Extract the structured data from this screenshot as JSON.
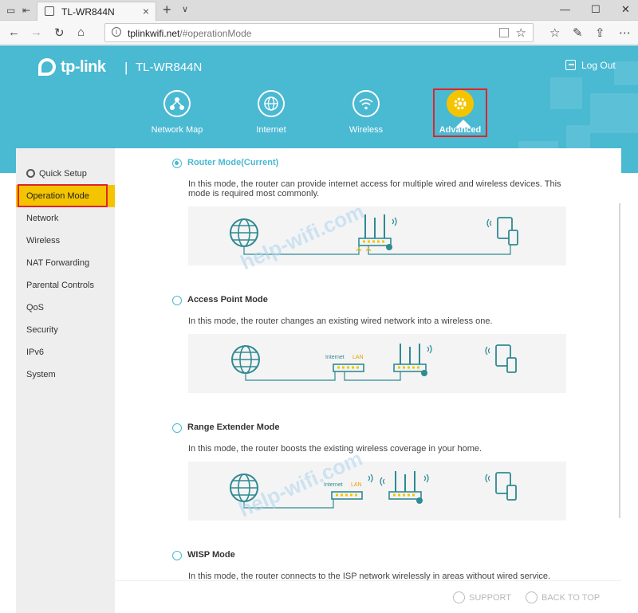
{
  "browser": {
    "tab_title": "TL-WR844N",
    "url_host": "tplinkwifi.net",
    "url_path": "/#operationMode"
  },
  "header": {
    "brand": "tp-link",
    "model": "TL-WR844N",
    "logout": "Log Out",
    "nav": [
      {
        "label": "Network Map",
        "icon": "network-map-icon"
      },
      {
        "label": "Internet",
        "icon": "globe-icon"
      },
      {
        "label": "Wireless",
        "icon": "wifi-icon"
      },
      {
        "label": "Advanced",
        "icon": "gear-icon"
      }
    ],
    "active_nav": "Advanced"
  },
  "sidebar": {
    "items": [
      {
        "label": "Quick Setup"
      },
      {
        "label": "Operation Mode"
      },
      {
        "label": "Network"
      },
      {
        "label": "Wireless"
      },
      {
        "label": "NAT Forwarding"
      },
      {
        "label": "Parental Controls"
      },
      {
        "label": "QoS"
      },
      {
        "label": "Security"
      },
      {
        "label": "IPv6"
      },
      {
        "label": "System"
      }
    ],
    "active_item": "Operation Mode"
  },
  "modes": [
    {
      "title": "Router Mode(Current)",
      "selected": true,
      "desc": "In this mode, the router can provide internet access for multiple wired and wireless devices. This mode is required most commonly."
    },
    {
      "title": "Access Point Mode",
      "selected": false,
      "desc": "In this mode, the router changes an existing wired network into a wireless one."
    },
    {
      "title": "Range Extender Mode",
      "selected": false,
      "desc": "In this mode, the router boosts the existing wireless coverage in your home."
    },
    {
      "title": "WISP Mode",
      "selected": false,
      "desc": "In this mode, the router connects to the ISP network wirelessly in areas without wired service."
    }
  ],
  "diagram_labels": {
    "internet": "Internet",
    "lan": "LAN"
  },
  "footer": {
    "support": "SUPPORT",
    "back_to_top": "BACK TO TOP"
  },
  "watermark": "help-wifi.com",
  "colors": {
    "accent": "#4ab9d2",
    "active": "#f5c400",
    "highlight": "#e0242b",
    "icon": "#2e8a93"
  }
}
